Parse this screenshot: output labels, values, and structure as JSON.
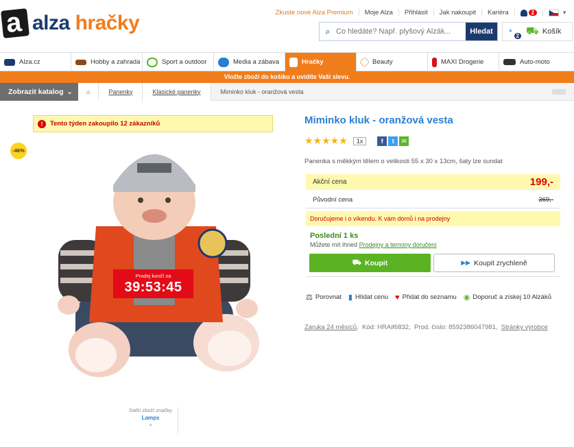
{
  "header": {
    "logo_alza": "alza",
    "logo_hracky": "hračky",
    "links": [
      "Zkuste nové Alza Premium",
      "Moje Alza",
      "Přihlásit",
      "Jak nakoupit",
      "Kariéra"
    ],
    "notifications": "2",
    "search_placeholder": "Co hledáte? Např. plyšový Alzák...",
    "search_button": "Hledat",
    "cart_count": "2",
    "cart_label": "Košík"
  },
  "categories": [
    {
      "label": "Alza.cz",
      "icon": "laptop-icon",
      "color": "#1d3a6e"
    },
    {
      "label": "Hobby a zahrada",
      "icon": "drill-icon",
      "color": "#8b4a1c"
    },
    {
      "label": "Sport a outdoor",
      "icon": "bike-icon",
      "color": "#5cb52a"
    },
    {
      "label": "Media a zábava",
      "icon": "play-icon",
      "color": "#2a7fd0"
    },
    {
      "label": "Hračky",
      "icon": "robot-icon",
      "color": "#ffffff"
    },
    {
      "label": "Beauty",
      "icon": "diamond-icon",
      "color": "#e8b07a"
    },
    {
      "label": "MAXI Drogerie",
      "icon": "bottle-icon",
      "color": "#d7141a"
    },
    {
      "label": "Auto-moto",
      "icon": "car-icon",
      "color": "#333333"
    }
  ],
  "promo": "Vložte zboží do košíku a uvidíte Vaši slevu.",
  "breadcrumb": {
    "catalog_button": "Zobrazit katalog",
    "items": [
      "Panenky",
      "Klasické panenky"
    ],
    "current": "Miminko kluk - oranžová vesta"
  },
  "left": {
    "sold_notice": "Tento týden zakoupilo 12 zákazníků",
    "discount": "-46%",
    "countdown_label": "Prodej končí za",
    "countdown_time": "39:53:45",
    "brand_more_label": "Další zboží značky",
    "brand_name": "Lamps"
  },
  "product": {
    "title": "Miminko kluk - oranžová vesta",
    "stars": "★★★★★",
    "rating_count": "1x",
    "description": "Panenka s měkkým tělem o velikosti 55 x 30 x 13cm, šaty lze sundat",
    "sale_label": "Akční cena",
    "sale_price": "199,-",
    "orig_label": "Původní cena",
    "orig_price": "369,-",
    "delivery": "Doručujeme i o víkendu. K vám domů i na prodejny",
    "stock": "Poslední 1 ks",
    "stock_detail_prefix": "Můžete mít ihned",
    "stock_detail_link": "Prodejny a termíny doručení",
    "buy_label": "Koupit",
    "quick_label": "Koupit zrychleně",
    "actions": [
      "Porovnat",
      "Hlídat cenu",
      "Přidat do seznamu",
      "Doporuč a získej 10 Alzáků"
    ],
    "warranty": "Záruka 24 měsíců",
    "code": "Kód: HRAif6832",
    "prod_number": "Prod. číslo: 8592386047981",
    "maker_link": "Stránky výrobce"
  }
}
